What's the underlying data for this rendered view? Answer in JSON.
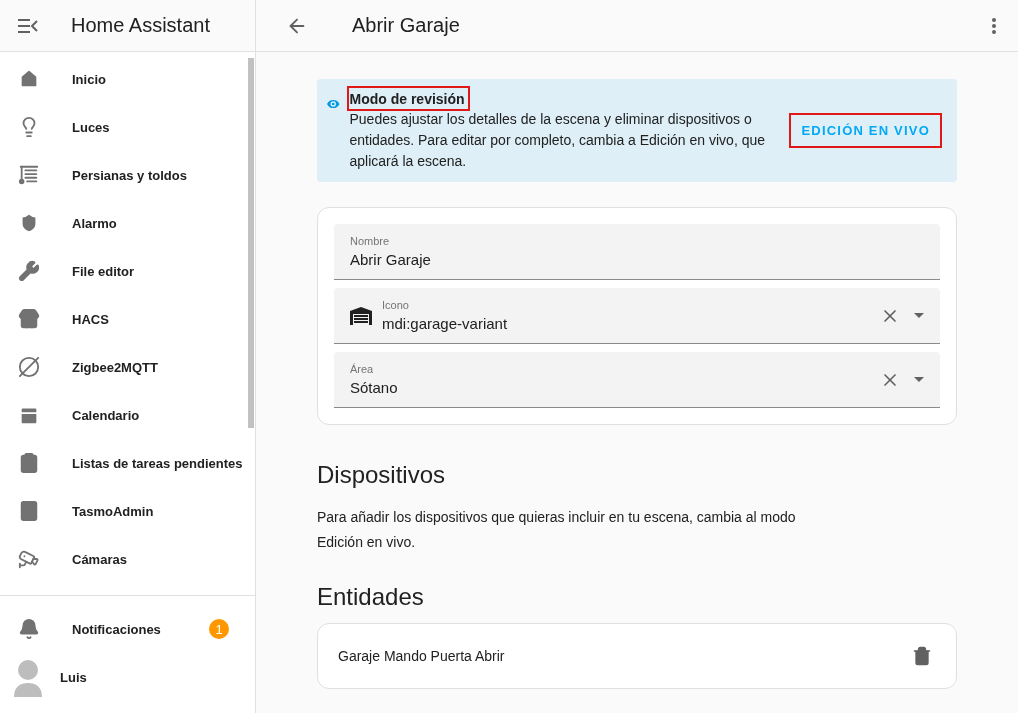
{
  "sidebar": {
    "title": "Home Assistant",
    "items": [
      {
        "label": "Inicio"
      },
      {
        "label": "Luces"
      },
      {
        "label": "Persianas y toldos"
      },
      {
        "label": "Alarmo"
      },
      {
        "label": "File editor"
      },
      {
        "label": "HACS"
      },
      {
        "label": "Zigbee2MQTT"
      },
      {
        "label": "Calendario"
      },
      {
        "label": "Listas de tareas pendientes"
      },
      {
        "label": "TasmoAdmin"
      },
      {
        "label": "Cámaras"
      }
    ],
    "notifications": {
      "label": "Notificaciones",
      "count": "1"
    },
    "user": {
      "name": "Luis"
    }
  },
  "header": {
    "title": "Abrir Garaje"
  },
  "banner": {
    "title": "Modo de revisión",
    "title_highlighted": true,
    "text": "Puedes ajustar los detalles de la escena y eliminar dispositivos o entidades. Para editar por completo, cambia a Edición en vivo, que aplicará la escena.",
    "button": "EDICIÓN EN VIVO",
    "button_highlighted": true
  },
  "fields": [
    {
      "kind": "text",
      "label": "Nombre",
      "value": "Abrir Garaje"
    },
    {
      "kind": "icon-picker",
      "label": "Icono",
      "value": "mdi:garage-variant"
    },
    {
      "kind": "select",
      "label": "Área",
      "value": "Sótano"
    }
  ],
  "devices": {
    "heading": "Dispositivos",
    "text": "Para añadir los dispositivos que quieras incluir en tu escena, cambia al modo Edición en vivo."
  },
  "entities": {
    "heading": "Entidades",
    "rows": [
      {
        "name": "Garaje Mando Puerta Abrir"
      }
    ]
  }
}
